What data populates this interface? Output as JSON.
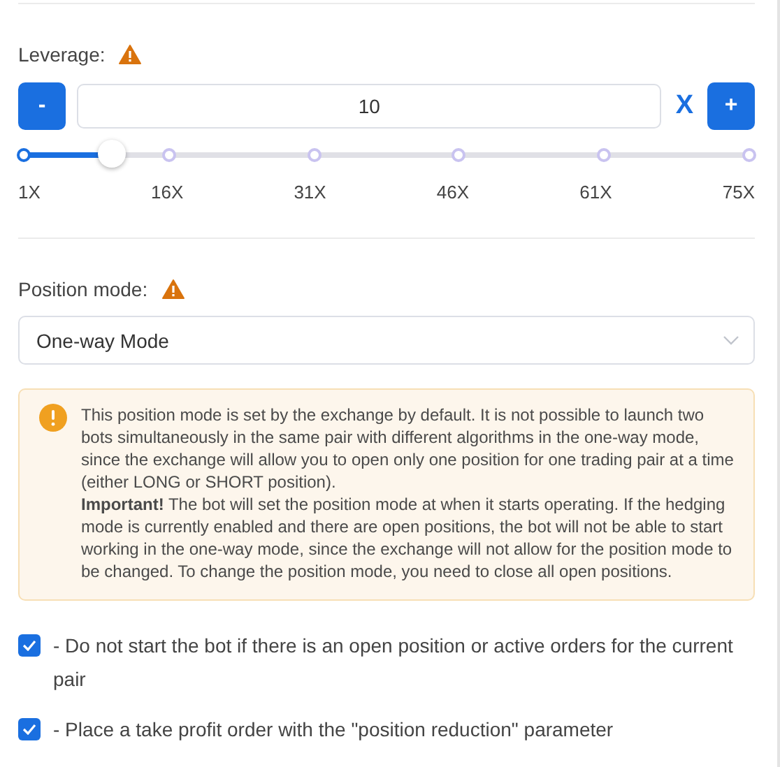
{
  "leverage": {
    "label": "Leverage:",
    "warning": true,
    "decrement": "-",
    "value": "10",
    "unit": "X",
    "increment": "+",
    "level": 0.122,
    "ticks": [
      "1X",
      "16X",
      "31X",
      "46X",
      "61X",
      "75X"
    ]
  },
  "position_mode": {
    "label": "Position mode:",
    "warning": true,
    "value": "One-way Mode"
  },
  "notice": {
    "paragraphs": [
      "This position mode is set by the exchange by default. It is not possible to launch two bots simultaneously in the same pair with different algorithms in the one-way mode, since the exchange will allow you to open only one position for one trading pair at a time (either LONG or SHORT position).",
      "**Important!** The bot will set the position mode at when it starts operating. If the hedging mode is currently enabled and there are open positions, the bot will not be able to start working in the one-way mode, since the exchange will not allow for the position mode to be changed. To change the position mode, you need to close all open positions."
    ]
  },
  "options": [
    {
      "label": "- Do not start the bot if there is an open position or active orders for the current pair",
      "checked": true
    },
    {
      "label": "- Place a take profit order with the \"position reduction\" parameter",
      "checked": true
    }
  ]
}
